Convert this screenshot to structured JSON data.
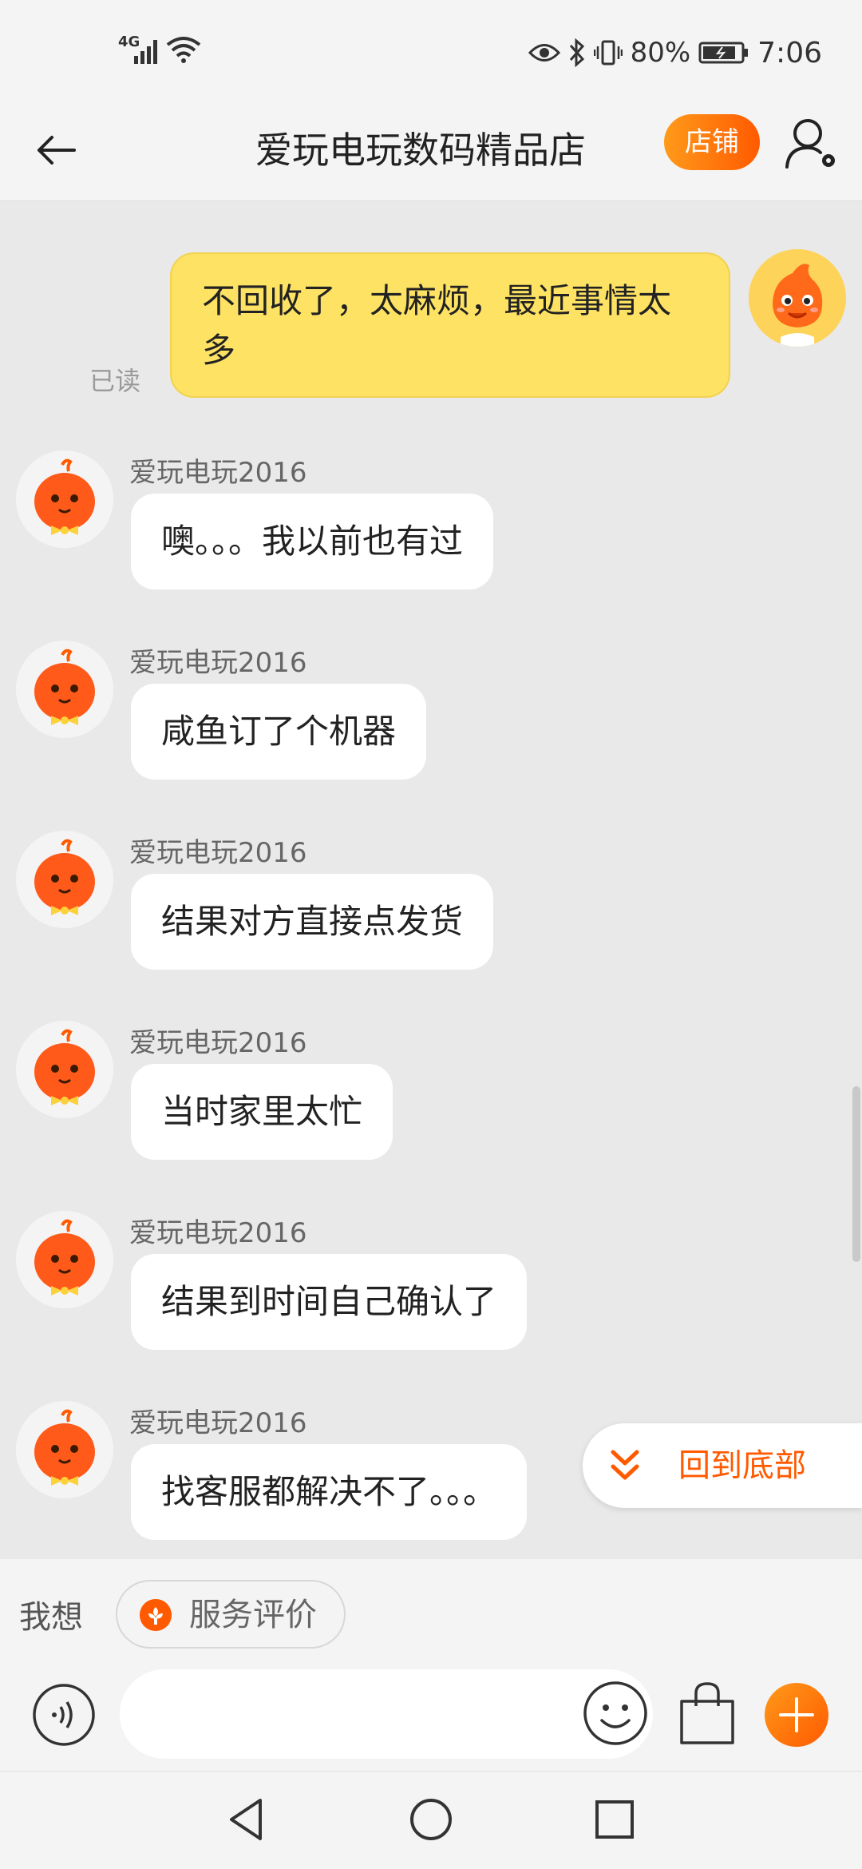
{
  "status_bar": {
    "network": "4G",
    "battery_percent": "80%",
    "time": "7:06",
    "icons": [
      "signal-icon",
      "wifi-icon",
      "eye-icon",
      "bluetooth-icon",
      "vibrate-icon",
      "battery-icon"
    ]
  },
  "header": {
    "title": "爱玩电玩数码精品店",
    "store_button": "店铺",
    "back_icon": "back-arrow-icon",
    "profile_icon": "user-settings-icon"
  },
  "chat": {
    "my_message": {
      "text": "不回收了，太麻烦，最近事情太多",
      "read_status": "已读"
    },
    "messages": [
      {
        "sender": "爱玩电玩2016",
        "text": "噢。。。我以前也有过"
      },
      {
        "sender": "爱玩电玩2016",
        "text": "咸鱼订了个机器"
      },
      {
        "sender": "爱玩电玩2016",
        "text": "结果对方直接点发货"
      },
      {
        "sender": "爱玩电玩2016",
        "text": "当时家里太忙"
      },
      {
        "sender": "爱玩电玩2016",
        "text": "结果到时间自己确认了"
      },
      {
        "sender": "爱玩电玩2016",
        "text": "找客服都解决不了。。。"
      }
    ],
    "back_to_bottom": "回到底部"
  },
  "quick_reply": {
    "label": "我想",
    "chip": "服务评价"
  },
  "input_bar": {
    "placeholder": "",
    "icons": [
      "voice-icon",
      "emoji-icon",
      "shopping-bag-icon",
      "plus-icon"
    ]
  },
  "colors": {
    "accent": "#ff5a00",
    "my_bubble": "#fde264",
    "chat_bg": "#e9e9e9"
  }
}
